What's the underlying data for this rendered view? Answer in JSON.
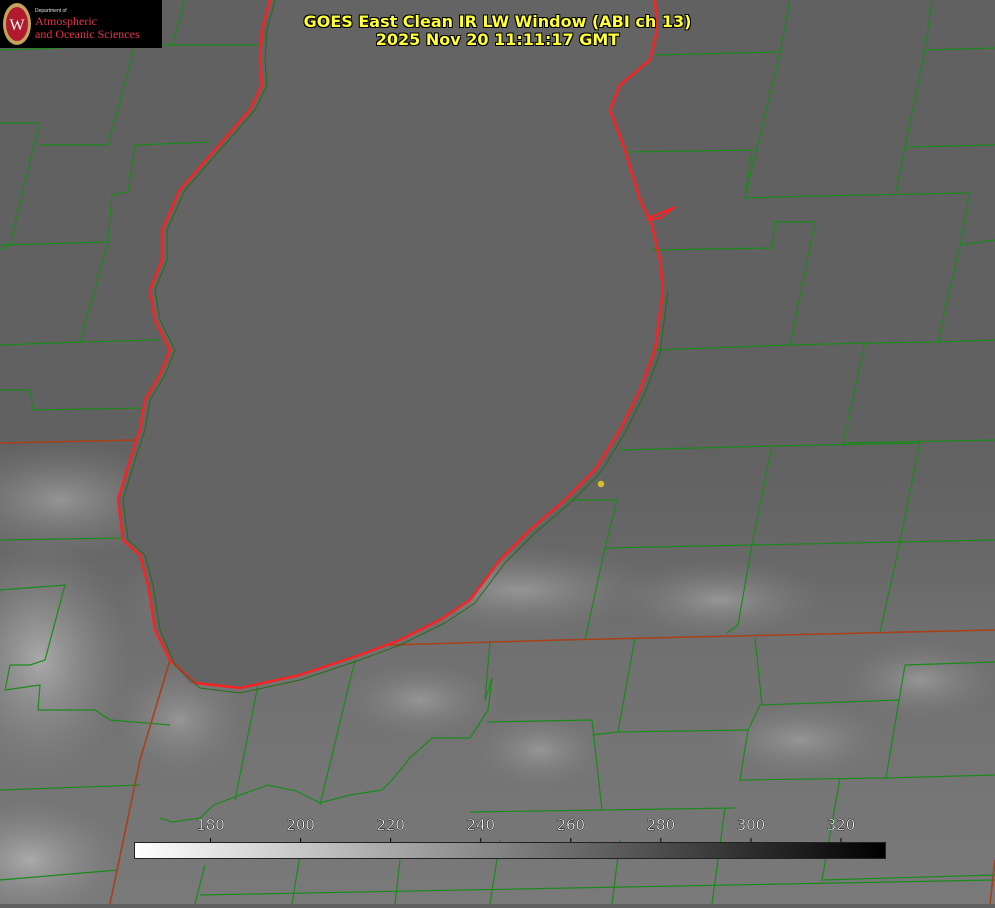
{
  "header": {
    "title": "GOES East Clean IR LW Window (ABI ch 13)",
    "timestamp": "2025 Nov 20 11:11:17 GMT"
  },
  "logo": {
    "department": "Department of",
    "line1": "Atmospheric",
    "line2": "and Oceanic Sciences",
    "seal_letter": "W"
  },
  "colorbar": {
    "ticks": [
      "180",
      "200",
      "220",
      "240",
      "260",
      "280",
      "300",
      "320"
    ],
    "min_value": 163,
    "max_value": 330,
    "color_low": "#ffffff",
    "color_high": "#000000"
  },
  "colors": {
    "county_lines": "#1a8a1a",
    "state_lines": "#a8401a",
    "coastline": "#ff2020",
    "text": "#ffff3a",
    "marker": "#d8c020"
  },
  "marker": {
    "icon": "location-dot-icon"
  }
}
